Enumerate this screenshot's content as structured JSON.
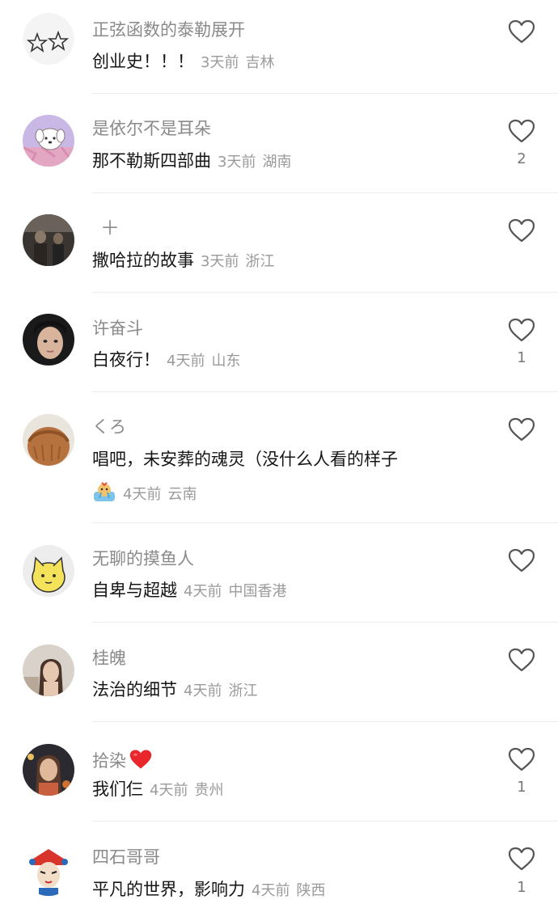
{
  "comments": [
    {
      "username": "正弦函数的泰勒展开",
      "text": "创业史！！！",
      "time": "3天前",
      "location": "吉林",
      "likes": "",
      "avatar_icon": "stars-sketch-avatar"
    },
    {
      "username": "是依尔不是耳朵",
      "text": "那不勒斯四部曲",
      "time": "3天前",
      "location": "湖南",
      "likes": "2",
      "avatar_icon": "puppy-cartoon-avatar"
    },
    {
      "username": "＋",
      "text": "撒哈拉的故事",
      "time": "3天前",
      "location": "浙江",
      "likes": "",
      "avatar_icon": "dark-photo-avatar"
    },
    {
      "username": "许奋斗",
      "text": "白夜行！",
      "time": "4天前",
      "location": "山东",
      "likes": "1",
      "avatar_icon": "girl-selfie-avatar"
    },
    {
      "username": "くろ",
      "text": "唱吧，未安葬的魂灵（没什么人看的样子",
      "time": "4天前",
      "location": "云南",
      "likes": "",
      "avatar_icon": "highland-cow-avatar",
      "sticker": "crying-sticker-icon"
    },
    {
      "username": "无聊的摸鱼人",
      "text": "自卑与超越",
      "time": "4天前",
      "location": "中国香港",
      "likes": "",
      "avatar_icon": "yellow-cat-cartoon-avatar"
    },
    {
      "username": "桂魄",
      "text": "法治的细节",
      "time": "4天前",
      "location": "浙江",
      "likes": "",
      "avatar_icon": "girl-portrait-avatar"
    },
    {
      "username": "拾染",
      "text": "我们仨",
      "time": "4天前",
      "location": "贵州",
      "likes": "1",
      "avatar_icon": "woman-photo-avatar",
      "name_emoji": "red-heart-icon"
    },
    {
      "username": "四石哥哥",
      "text": "平凡的世界，影响力",
      "time": "4天前",
      "location": "陕西",
      "likes": "1",
      "avatar_icon": "opera-mask-avatar"
    }
  ],
  "colors": {
    "username": "#8a8a8a",
    "text": "#161616",
    "meta": "#9a9a9a",
    "heart_outline": "#555555",
    "emoji_heart": "#e8262b"
  }
}
